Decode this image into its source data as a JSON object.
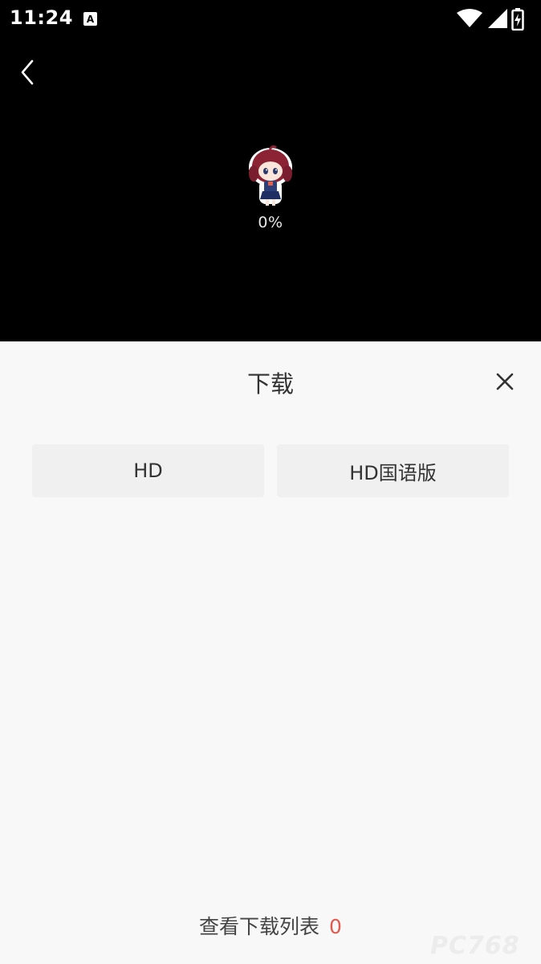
{
  "status_bar": {
    "time": "11:24",
    "keyboard_glyph": "A",
    "icons": [
      "keyboard-icon",
      "wifi-icon",
      "signal-icon",
      "battery-icon"
    ]
  },
  "player": {
    "back_icon": "chevron-left-icon",
    "loading_percent": "0%",
    "mascot_icon": "anime-girl-mascot"
  },
  "download_sheet": {
    "title": "下载",
    "close_icon": "close-icon",
    "quality_options": [
      {
        "label": "HD"
      },
      {
        "label": "HD国语版"
      }
    ],
    "footer_link": "查看下载列表",
    "download_count": "0"
  },
  "watermark": "PC768",
  "colors": {
    "player_background": "#000000",
    "sheet_background": "#f8f8f8",
    "option_background": "#f0f0f0",
    "count_accent": "#e05a4e"
  }
}
